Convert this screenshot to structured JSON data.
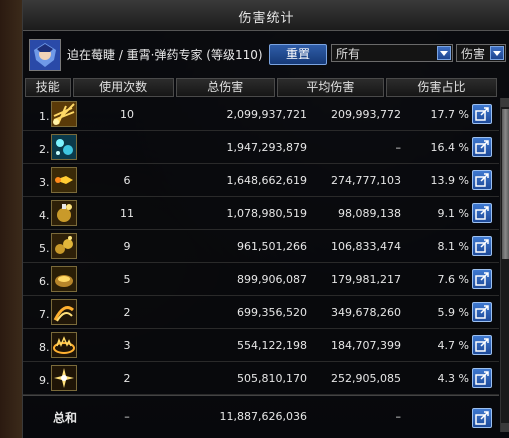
{
  "window": {
    "title": "伤害统计"
  },
  "character": {
    "info": "迫在莓睫 / 重霄·弹药专家 (等级110)"
  },
  "controls": {
    "reset_label": "重置",
    "filter_value": "所有",
    "metric_value": "伤害"
  },
  "columns": [
    "技能",
    "使用次数",
    "总伤害",
    "平均伤害",
    "伤害占比"
  ],
  "rows": [
    {
      "idx": "1.",
      "icon": "golden-burst-skill-icon",
      "uses": "10",
      "total": "2,099,937,721",
      "avg": "209,993,772",
      "pct": "17.7 %"
    },
    {
      "idx": "2.",
      "icon": "ice-shard-skill-icon",
      "uses": "",
      "total": "1,947,293,879",
      "avg": "–",
      "pct": "16.4 %"
    },
    {
      "idx": "3.",
      "icon": "fire-bullet-skill-icon",
      "uses": "6",
      "total": "1,648,662,619",
      "avg": "274,777,103",
      "pct": "13.9 %"
    },
    {
      "idx": "4.",
      "icon": "grenade-skill-icon",
      "uses": "11",
      "total": "1,078,980,519",
      "avg": "98,089,138",
      "pct": "9.1 %"
    },
    {
      "idx": "5.",
      "icon": "cluster-grenade-skill-icon",
      "uses": "9",
      "total": "961,501,266",
      "avg": "106,833,474",
      "pct": "8.1 %"
    },
    {
      "idx": "6.",
      "icon": "landmine-skill-icon",
      "uses": "5",
      "total": "899,906,087",
      "avg": "179,981,217",
      "pct": "7.6 %"
    },
    {
      "idx": "7.",
      "icon": "flame-slash-skill-icon",
      "uses": "2",
      "total": "699,356,520",
      "avg": "349,678,260",
      "pct": "5.9 %"
    },
    {
      "idx": "8.",
      "icon": "ground-fire-skill-icon",
      "uses": "3",
      "total": "554,122,198",
      "avg": "184,707,399",
      "pct": "4.7 %"
    },
    {
      "idx": "9.",
      "icon": "star-blast-skill-icon",
      "uses": "2",
      "total": "505,810,170",
      "avg": "252,905,085",
      "pct": "4.3 %"
    }
  ],
  "summary": {
    "label": "总和",
    "uses": "–",
    "total": "11,887,626,036",
    "avg": "–"
  },
  "colors": {
    "accent_blue": "#2f5da8",
    "panel_bg": "#08090c",
    "text": "#e6e6e6"
  }
}
